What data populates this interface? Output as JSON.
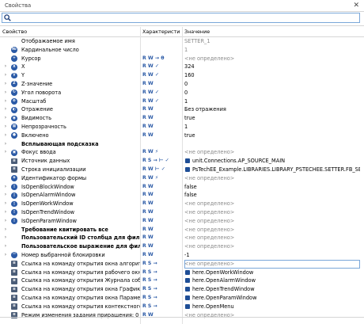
{
  "window": {
    "title": "Свойства",
    "close_glyph": "✕"
  },
  "search": {
    "placeholder": ""
  },
  "columns": {
    "property": "Свойство",
    "characteristics": "Характеристики",
    "value": "Значение"
  },
  "rows": [
    {
      "chev": "",
      "icon": "",
      "name": "Отображаемое имя",
      "bold": false,
      "flags": "",
      "value": "SETTER_1",
      "value_style": "grey"
    },
    {
      "chev": "",
      "icon": "№",
      "name": "Кардинальное число",
      "bold": false,
      "flags": "",
      "value": "1",
      "value_style": "grey"
    },
    {
      "chev": "",
      "icon": "+",
      "name": "Курсор",
      "bold": false,
      "flags": "R W → θ",
      "value": "<не определено>",
      "value_style": "grey"
    },
    {
      "chev": "›",
      "icon": "X",
      "name": "X",
      "bold": false,
      "flags": "R W ✓",
      "value": "324",
      "value_style": ""
    },
    {
      "chev": "›",
      "icon": "Y",
      "name": "Y",
      "bold": false,
      "flags": "R W ✓",
      "value": "160",
      "value_style": ""
    },
    {
      "chev": "›",
      "icon": "Z",
      "name": "Z-значение",
      "bold": false,
      "flags": "R W",
      "value": "0",
      "value_style": ""
    },
    {
      "chev": "›",
      "icon": "↻",
      "name": "Угол поворота",
      "bold": false,
      "flags": "R W ✓",
      "value": "0",
      "value_style": ""
    },
    {
      "chev": "›",
      "icon": "⊕",
      "name": "Масштаб",
      "bold": false,
      "flags": "R W ✓",
      "value": "1",
      "value_style": ""
    },
    {
      "chev": "›",
      "icon": "◐",
      "name": "Отражение",
      "bold": false,
      "flags": "R W",
      "value": "Без отражения",
      "value_style": ""
    },
    {
      "chev": "›",
      "icon": "◉",
      "name": "Видимость",
      "bold": false,
      "flags": "R W",
      "value": "true",
      "value_style": ""
    },
    {
      "chev": "›",
      "icon": "▦",
      "name": "Непрозрачность",
      "bold": false,
      "flags": "R W",
      "value": "1",
      "value_style": ""
    },
    {
      "chev": "›",
      "icon": "●",
      "name": "Включено",
      "bold": false,
      "flags": "R W",
      "value": "true",
      "value_style": ""
    },
    {
      "chev": "›",
      "icon": "",
      "name": "Всплывающая подсказка",
      "bold": true,
      "flags": "",
      "value": "",
      "value_style": ""
    },
    {
      "chev": "›",
      "icon": "▣",
      "name": "Фокус ввода",
      "bold": false,
      "flags": "R W ⚡",
      "value": "<не определено>",
      "value_style": "grey"
    },
    {
      "chev": "",
      "icon": "≡",
      "name": "Источник данных",
      "bold": false,
      "flags": "R S → ⊢ ✓",
      "value": "unit.Connections.AP_SOURCE_MAIN",
      "value_style": "link"
    },
    {
      "chev": "",
      "icon": "≡",
      "name": "Строка инициализации",
      "bold": false,
      "flags": "R W ⊢ ✓",
      "value": "PsTechEE_Example.LIBRARIES.LIBRARY_PSTECHEE.SETTER.FB_SETTER",
      "value_style": "link"
    },
    {
      "chev": "",
      "icon": "◈",
      "name": "Идентификатор формы",
      "bold": false,
      "flags": "R W ⚡",
      "value": "<не определено>",
      "value_style": "grey"
    },
    {
      "chev": "›",
      "icon": "▯",
      "name": "IsOpenBlockWindow",
      "bold": false,
      "flags": "R W",
      "value": "false",
      "value_style": ""
    },
    {
      "chev": "›",
      "icon": "▯",
      "name": "IsOpenAlarmWindow",
      "bold": false,
      "flags": "R W",
      "value": "false",
      "value_style": ""
    },
    {
      "chev": "›",
      "icon": "▯",
      "name": "IsOpenWorkWindow",
      "bold": false,
      "flags": "R W",
      "value": "<не определено>",
      "value_style": "grey"
    },
    {
      "chev": "›",
      "icon": "▯",
      "name": "IsOpenTrendWindow",
      "bold": false,
      "flags": "R W",
      "value": "<не определено>",
      "value_style": "grey"
    },
    {
      "chev": "›",
      "icon": "▯",
      "name": "IsOpenParamWindow",
      "bold": false,
      "flags": "R W",
      "value": "<не определено>",
      "value_style": "grey"
    },
    {
      "chev": "›",
      "icon": "",
      "name": "Требование квитировать все",
      "bold": true,
      "flags": "R W",
      "value": "<не определено>",
      "value_style": "grey"
    },
    {
      "chev": "›",
      "icon": "",
      "name": "Пользовательский ID столбца для фильтра",
      "bold": true,
      "flags": "R W",
      "value": "<не определено>",
      "value_style": "grey"
    },
    {
      "chev": "›",
      "icon": "",
      "name": "Пользовательское выражение для фильтра",
      "bold": true,
      "flags": "R W",
      "value": "<не определено>",
      "value_style": "grey"
    },
    {
      "chev": "›",
      "icon": "¹²",
      "name": "Номер выбранной блокировки",
      "bold": false,
      "flags": "R W",
      "value": "-1",
      "value_style": ""
    },
    {
      "chev": "",
      "icon": "≡",
      "name": "Ссылка на команду открытия окна алгоритма б...",
      "bold": false,
      "flags": "R S →",
      "value": "<не определено>",
      "value_style": "grey",
      "selected": true
    },
    {
      "chev": "",
      "icon": "≡",
      "name": "Ссылка на команду открытия рабочего окна",
      "bold": false,
      "flags": "R S →",
      "value": "here.OpenWorkWindow",
      "value_style": "link"
    },
    {
      "chev": "",
      "icon": "≡",
      "name": "Ссылка на команду открытия Журнала событий",
      "bold": false,
      "flags": "R S →",
      "value": "here.OpenAlarmWindow",
      "value_style": "link"
    },
    {
      "chev": "",
      "icon": "≡",
      "name": "Ссылка на команду открытия окна Графиков",
      "bold": false,
      "flags": "R S →",
      "value": "here.OpenTrendWindow",
      "value_style": "link"
    },
    {
      "chev": "",
      "icon": "≡",
      "name": "Ссылка на команду открытия окна Параметры",
      "bold": false,
      "flags": "R S →",
      "value": "here.OpenParamWindow",
      "value_style": "link"
    },
    {
      "chev": "",
      "icon": "≡",
      "name": "Ссылка на команду открытия контекстного меню",
      "bold": false,
      "flags": "R S →",
      "value": "here.OpenMenu",
      "value_style": "link"
    },
    {
      "chev": "",
      "icon": "≡",
      "name": "Режим изменения задания приращения: 0 - не и...",
      "bold": false,
      "flags": "R W",
      "value": "<не определено>",
      "value_style": "grey"
    }
  ]
}
